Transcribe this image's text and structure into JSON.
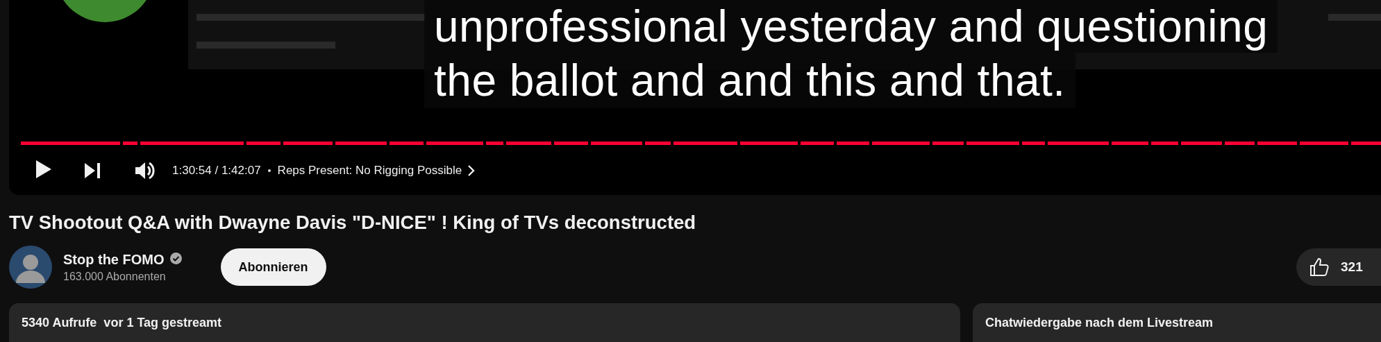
{
  "player": {
    "caption_lines": [
      "unprofessional yesterday and questioning",
      "the ballot and and this and that."
    ],
    "progress": {
      "level": 1
    },
    "playing": false,
    "time": "1:30:54 / 1:42:07",
    "chapter": "Reps Present: No Rigging Possible"
  },
  "video": {
    "title": "TV Shootout Q&A with Dwayne Davis \"D-NICE\" ! King of TVs deconstructed",
    "channel": {
      "name": "Stop the FOMO",
      "verified": true,
      "subscribers": "163.000 Abonnenten"
    },
    "subscribe_button": "Abonnieren",
    "likes": "321"
  },
  "description": {
    "stats": "5340 Aufrufe  vor 1 Tag gestreamt"
  },
  "chat_replay": {
    "title": "Chatwiedergabe nach dem Livestream"
  }
}
